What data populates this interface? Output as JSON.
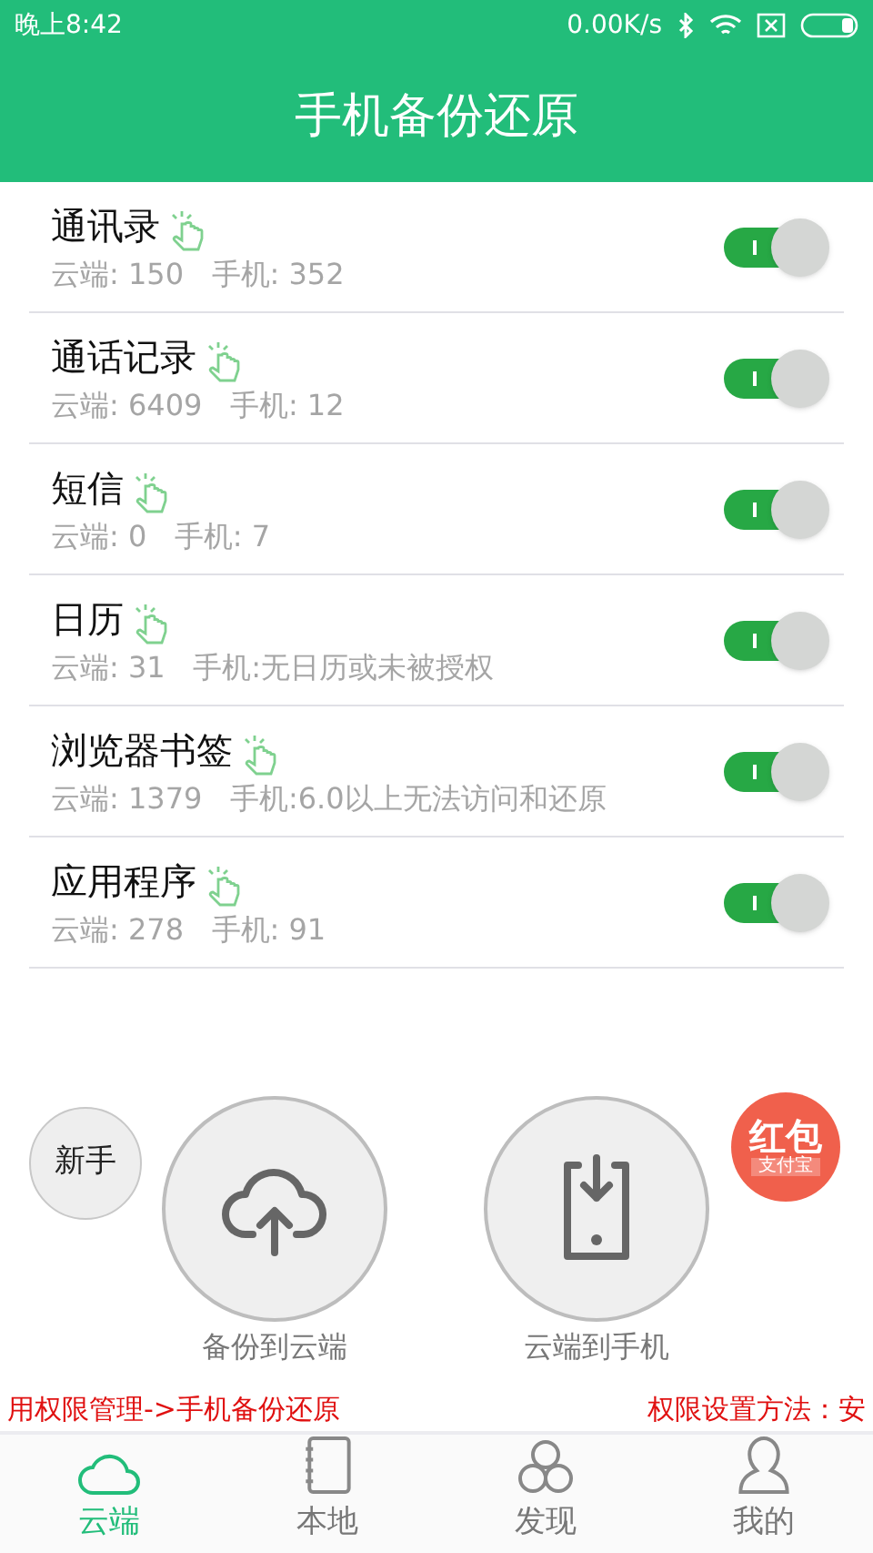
{
  "status_bar": {
    "time": "晚上8:42",
    "speed": "0.00K/s"
  },
  "title": "手机备份还原",
  "items": [
    {
      "name": "通讯录",
      "stats": "云端: 150   手机: 352",
      "on": true
    },
    {
      "name": "通话记录",
      "stats": "云端: 6409   手机: 12",
      "on": true
    },
    {
      "name": "短信",
      "stats": "云端: 0   手机: 7",
      "on": true
    },
    {
      "name": "日历",
      "stats": "云端: 31   手机:无日历或未被授权",
      "on": true
    },
    {
      "name": "浏览器书签",
      "stats": "云端: 1379   手机:6.0以上无法访问和还原",
      "on": true
    },
    {
      "name": "应用程序",
      "stats": "云端: 278   手机: 91",
      "on": true
    }
  ],
  "newbie_button": "新手",
  "red_packet": {
    "title": "红包",
    "subtitle": "支付宝"
  },
  "actions": [
    {
      "kind": "upload",
      "label": "备份到云端"
    },
    {
      "kind": "download",
      "label": "云端到手机"
    }
  ],
  "ticker": {
    "left": "用权限管理->手机备份还原",
    "right": "权限设置方法：安"
  },
  "tabs": [
    {
      "kind": "cloud",
      "label": "云端",
      "selected": true
    },
    {
      "kind": "notebook",
      "label": "本地",
      "selected": false
    },
    {
      "kind": "circles",
      "label": "发现",
      "selected": false
    },
    {
      "kind": "person",
      "label": "我的",
      "selected": false
    }
  ]
}
